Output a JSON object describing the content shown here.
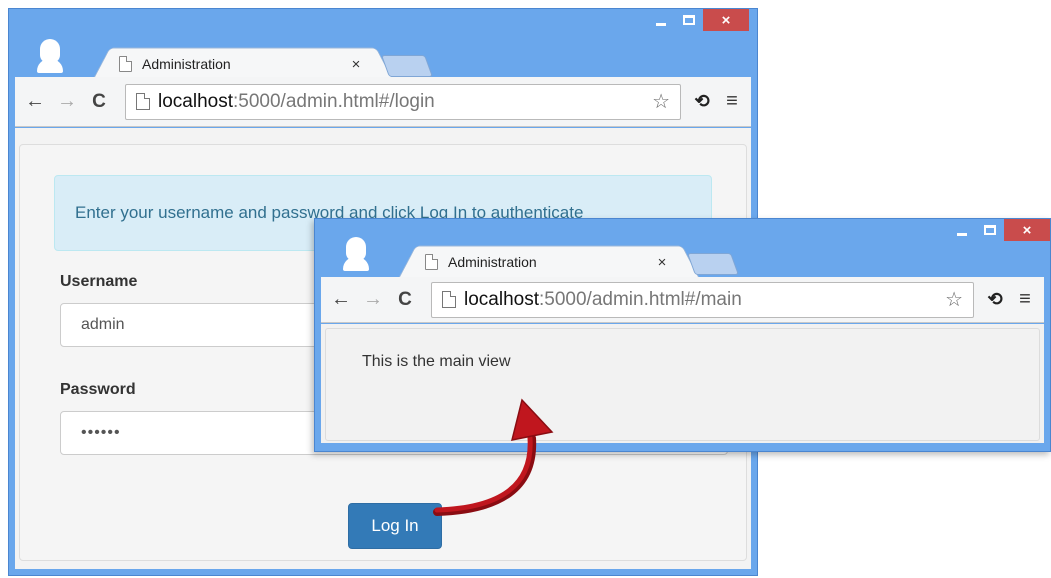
{
  "login_window": {
    "tab": {
      "title": "Administration",
      "close": "×"
    },
    "controls": {
      "minimize": "minimize",
      "maximize": "maximize",
      "close": "×"
    },
    "toolbar": {
      "back": "←",
      "forward": "→",
      "reload": "C",
      "url_host": "localhost",
      "url_rest": ":5000/admin.html#/login",
      "star": "☆",
      "extension": "⟲",
      "menu": "≡"
    },
    "alert": "Enter your username and password and click Log In to authenticate",
    "username_label": "Username",
    "username_value": "admin",
    "password_label": "Password",
    "password_value": "••••••",
    "login_button": "Log In"
  },
  "main_window": {
    "tab": {
      "title": "Administration",
      "close": "×"
    },
    "controls": {
      "minimize": "minimize",
      "maximize": "maximize",
      "close": "×"
    },
    "toolbar": {
      "back": "←",
      "forward": "→",
      "reload": "C",
      "url_host": "localhost",
      "url_rest": ":5000/admin.html#/main",
      "star": "☆",
      "extension": "⟲",
      "menu": "≡"
    },
    "main_text": "This is the main view"
  },
  "colors": {
    "window_frame": "#6aa7ec",
    "close_button": "#c94c4c",
    "alert_bg": "#d9edf7",
    "alert_text": "#31708f",
    "primary_button": "#337ab7",
    "arrow": "#c0161e"
  },
  "icons": [
    "profile-avatar-icon",
    "page-icon",
    "back-arrow-icon",
    "forward-arrow-icon",
    "reload-icon",
    "star-icon",
    "extension-icon",
    "menu-icon",
    "curved-arrow-icon"
  ]
}
